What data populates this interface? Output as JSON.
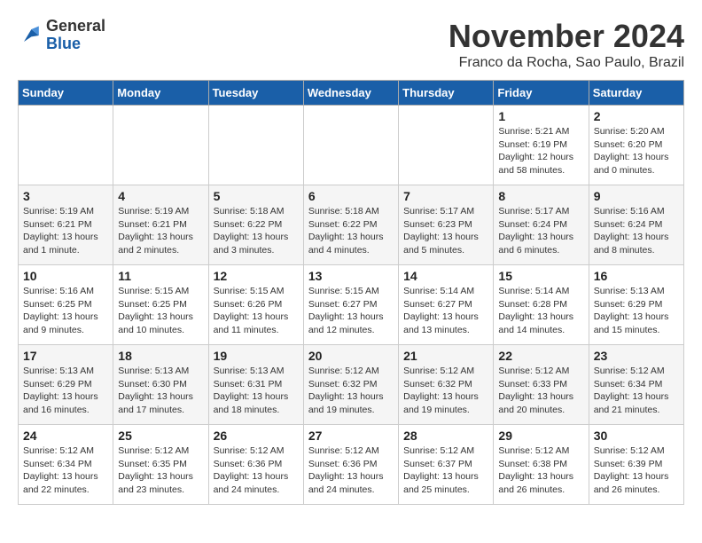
{
  "logo": {
    "general": "General",
    "blue": "Blue"
  },
  "title": "November 2024",
  "location": "Franco da Rocha, Sao Paulo, Brazil",
  "days_header": [
    "Sunday",
    "Monday",
    "Tuesday",
    "Wednesday",
    "Thursday",
    "Friday",
    "Saturday"
  ],
  "weeks": [
    [
      {
        "day": "",
        "info": ""
      },
      {
        "day": "",
        "info": ""
      },
      {
        "day": "",
        "info": ""
      },
      {
        "day": "",
        "info": ""
      },
      {
        "day": "",
        "info": ""
      },
      {
        "day": "1",
        "info": "Sunrise: 5:21 AM\nSunset: 6:19 PM\nDaylight: 12 hours\nand 58 minutes."
      },
      {
        "day": "2",
        "info": "Sunrise: 5:20 AM\nSunset: 6:20 PM\nDaylight: 13 hours\nand 0 minutes."
      }
    ],
    [
      {
        "day": "3",
        "info": "Sunrise: 5:19 AM\nSunset: 6:21 PM\nDaylight: 13 hours\nand 1 minute."
      },
      {
        "day": "4",
        "info": "Sunrise: 5:19 AM\nSunset: 6:21 PM\nDaylight: 13 hours\nand 2 minutes."
      },
      {
        "day": "5",
        "info": "Sunrise: 5:18 AM\nSunset: 6:22 PM\nDaylight: 13 hours\nand 3 minutes."
      },
      {
        "day": "6",
        "info": "Sunrise: 5:18 AM\nSunset: 6:22 PM\nDaylight: 13 hours\nand 4 minutes."
      },
      {
        "day": "7",
        "info": "Sunrise: 5:17 AM\nSunset: 6:23 PM\nDaylight: 13 hours\nand 5 minutes."
      },
      {
        "day": "8",
        "info": "Sunrise: 5:17 AM\nSunset: 6:24 PM\nDaylight: 13 hours\nand 6 minutes."
      },
      {
        "day": "9",
        "info": "Sunrise: 5:16 AM\nSunset: 6:24 PM\nDaylight: 13 hours\nand 8 minutes."
      }
    ],
    [
      {
        "day": "10",
        "info": "Sunrise: 5:16 AM\nSunset: 6:25 PM\nDaylight: 13 hours\nand 9 minutes."
      },
      {
        "day": "11",
        "info": "Sunrise: 5:15 AM\nSunset: 6:25 PM\nDaylight: 13 hours\nand 10 minutes."
      },
      {
        "day": "12",
        "info": "Sunrise: 5:15 AM\nSunset: 6:26 PM\nDaylight: 13 hours\nand 11 minutes."
      },
      {
        "day": "13",
        "info": "Sunrise: 5:15 AM\nSunset: 6:27 PM\nDaylight: 13 hours\nand 12 minutes."
      },
      {
        "day": "14",
        "info": "Sunrise: 5:14 AM\nSunset: 6:27 PM\nDaylight: 13 hours\nand 13 minutes."
      },
      {
        "day": "15",
        "info": "Sunrise: 5:14 AM\nSunset: 6:28 PM\nDaylight: 13 hours\nand 14 minutes."
      },
      {
        "day": "16",
        "info": "Sunrise: 5:13 AM\nSunset: 6:29 PM\nDaylight: 13 hours\nand 15 minutes."
      }
    ],
    [
      {
        "day": "17",
        "info": "Sunrise: 5:13 AM\nSunset: 6:29 PM\nDaylight: 13 hours\nand 16 minutes."
      },
      {
        "day": "18",
        "info": "Sunrise: 5:13 AM\nSunset: 6:30 PM\nDaylight: 13 hours\nand 17 minutes."
      },
      {
        "day": "19",
        "info": "Sunrise: 5:13 AM\nSunset: 6:31 PM\nDaylight: 13 hours\nand 18 minutes."
      },
      {
        "day": "20",
        "info": "Sunrise: 5:12 AM\nSunset: 6:32 PM\nDaylight: 13 hours\nand 19 minutes."
      },
      {
        "day": "21",
        "info": "Sunrise: 5:12 AM\nSunset: 6:32 PM\nDaylight: 13 hours\nand 19 minutes."
      },
      {
        "day": "22",
        "info": "Sunrise: 5:12 AM\nSunset: 6:33 PM\nDaylight: 13 hours\nand 20 minutes."
      },
      {
        "day": "23",
        "info": "Sunrise: 5:12 AM\nSunset: 6:34 PM\nDaylight: 13 hours\nand 21 minutes."
      }
    ],
    [
      {
        "day": "24",
        "info": "Sunrise: 5:12 AM\nSunset: 6:34 PM\nDaylight: 13 hours\nand 22 minutes."
      },
      {
        "day": "25",
        "info": "Sunrise: 5:12 AM\nSunset: 6:35 PM\nDaylight: 13 hours\nand 23 minutes."
      },
      {
        "day": "26",
        "info": "Sunrise: 5:12 AM\nSunset: 6:36 PM\nDaylight: 13 hours\nand 24 minutes."
      },
      {
        "day": "27",
        "info": "Sunrise: 5:12 AM\nSunset: 6:36 PM\nDaylight: 13 hours\nand 24 minutes."
      },
      {
        "day": "28",
        "info": "Sunrise: 5:12 AM\nSunset: 6:37 PM\nDaylight: 13 hours\nand 25 minutes."
      },
      {
        "day": "29",
        "info": "Sunrise: 5:12 AM\nSunset: 6:38 PM\nDaylight: 13 hours\nand 26 minutes."
      },
      {
        "day": "30",
        "info": "Sunrise: 5:12 AM\nSunset: 6:39 PM\nDaylight: 13 hours\nand 26 minutes."
      }
    ]
  ]
}
